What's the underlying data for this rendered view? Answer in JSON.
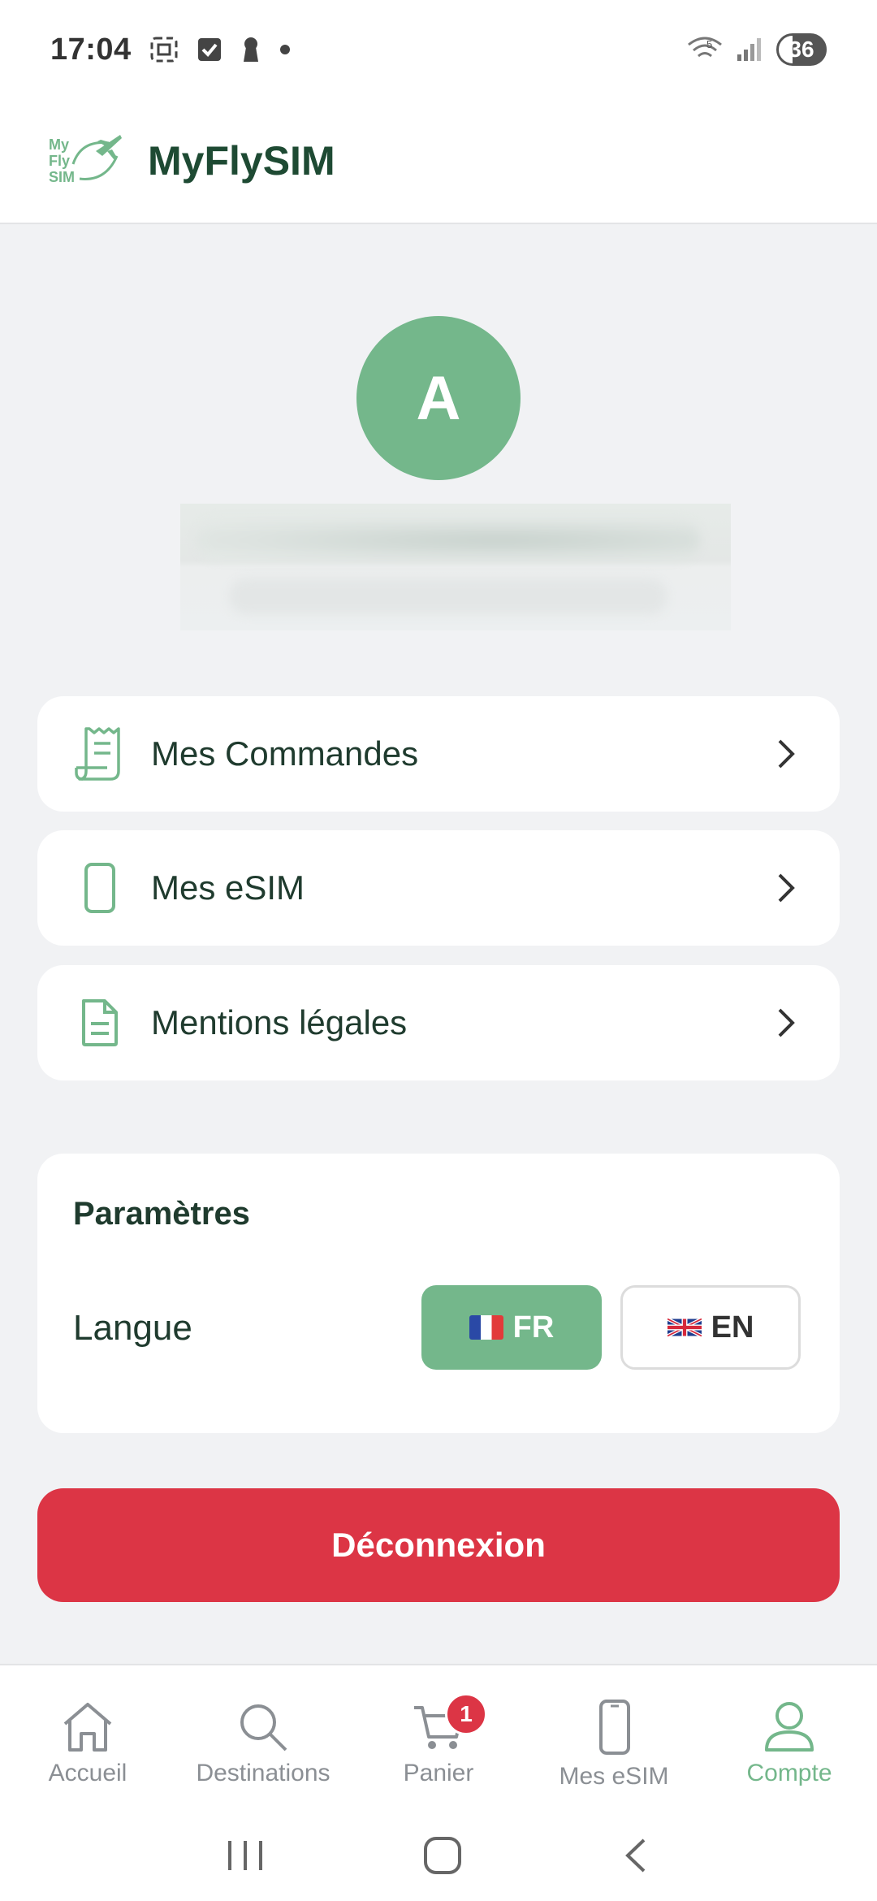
{
  "status_bar": {
    "time": "17:04",
    "battery": "36",
    "left_icons": [
      "screenshot-icon",
      "checkbox-icon",
      "keyhole-icon",
      "dot-icon"
    ],
    "right_icons": [
      "wifi-icon",
      "signal-icon",
      "battery-icon"
    ]
  },
  "header": {
    "logo_text": [
      "My",
      "Fly",
      "SIM"
    ],
    "title": "MyFlySIM"
  },
  "profile": {
    "avatar_initial": "A"
  },
  "menu": [
    {
      "label": "Mes Commandes",
      "icon": "receipt-icon"
    },
    {
      "label": "Mes eSIM",
      "icon": "phone-icon"
    },
    {
      "label": "Mentions légales",
      "icon": "document-icon"
    }
  ],
  "settings": {
    "title": "Paramètres",
    "language_label": "Langue",
    "languages": [
      {
        "code": "FR",
        "selected": true,
        "flag": "flag-fr"
      },
      {
        "code": "EN",
        "selected": false,
        "flag": "flag-uk"
      }
    ]
  },
  "logout": {
    "label": "Déconnexion"
  },
  "bottom_nav": [
    {
      "label": "Accueil",
      "icon": "home-icon",
      "active": false
    },
    {
      "label": "Destinations",
      "icon": "search-icon",
      "active": false
    },
    {
      "label": "Panier",
      "icon": "cart-icon",
      "active": false,
      "badge": "1"
    },
    {
      "label": "Mes eSIM",
      "icon": "phone-icon",
      "active": false
    },
    {
      "label": "Compte",
      "icon": "user-icon",
      "active": true
    }
  ],
  "colors": {
    "accent": "#74b78b",
    "title": "#1e4a33",
    "danger": "#dc3545",
    "background": "#f1f2f4"
  }
}
